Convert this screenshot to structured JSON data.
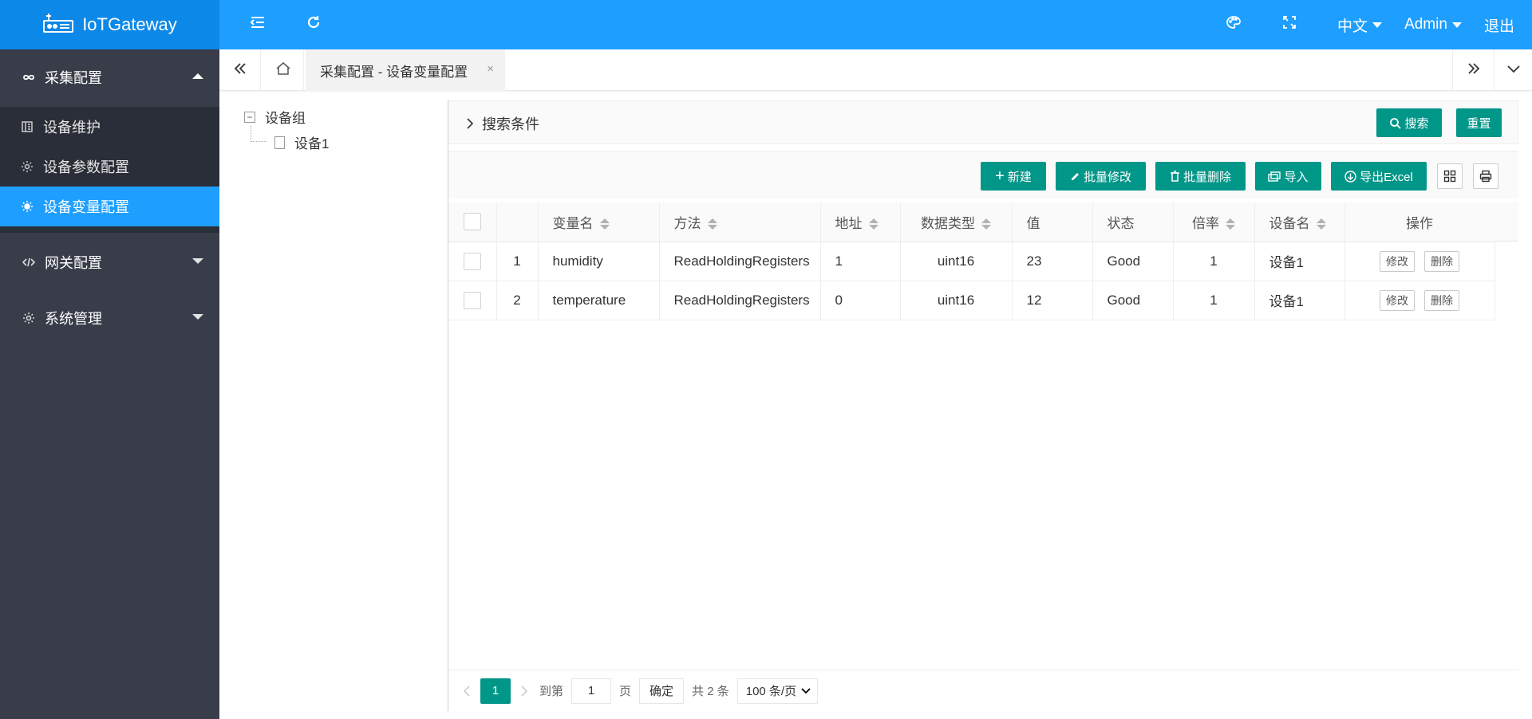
{
  "app": {
    "title": "IoTGateway"
  },
  "header": {
    "language": "中文",
    "user": "Admin",
    "logout": "退出"
  },
  "sidebar": {
    "groups": [
      {
        "label": "采集配置",
        "expanded": true
      },
      {
        "label": "网关配置",
        "expanded": false
      },
      {
        "label": "系统管理",
        "expanded": false
      }
    ],
    "items": [
      {
        "label": "设备维护"
      },
      {
        "label": "设备参数配置"
      },
      {
        "label": "设备变量配置",
        "active": true
      }
    ]
  },
  "tabs": {
    "active": "采集配置 - 设备变量配置",
    "close": "×"
  },
  "tree": {
    "root": "设备组",
    "toggle": "−",
    "children": [
      "设备1"
    ]
  },
  "search": {
    "title": "搜索条件",
    "search_label": "搜索",
    "reset_label": "重置"
  },
  "toolbar": {
    "new_label": "新建",
    "batch_edit_label": "批量修改",
    "batch_delete_label": "批量删除",
    "import_label": "导入",
    "export_label": "导出Excel"
  },
  "table": {
    "columns": [
      "变量名",
      "方法",
      "地址",
      "数据类型",
      "值",
      "状态",
      "倍率",
      "设备名",
      "操作"
    ],
    "rows": [
      {
        "index": "1",
        "name": "humidity",
        "method": "ReadHoldingRegisters",
        "address": "1",
        "type": "uint16",
        "value": "23",
        "status": "Good",
        "ratio": "1",
        "device": "设备1"
      },
      {
        "index": "2",
        "name": "temperature",
        "method": "ReadHoldingRegisters",
        "address": "0",
        "type": "uint16",
        "value": "12",
        "status": "Good",
        "ratio": "1",
        "device": "设备1"
      }
    ],
    "edit_label": "修改",
    "delete_label": "删除"
  },
  "pager": {
    "current": "1",
    "goto": "到第",
    "page_input": "1",
    "page_unit": "页",
    "confirm": "确定",
    "total": "共 2 条",
    "page_size": "100 条/页"
  },
  "colors": {
    "header": "#1E9FFF",
    "sidebar": "#393D49",
    "primary_button": "#009688"
  }
}
